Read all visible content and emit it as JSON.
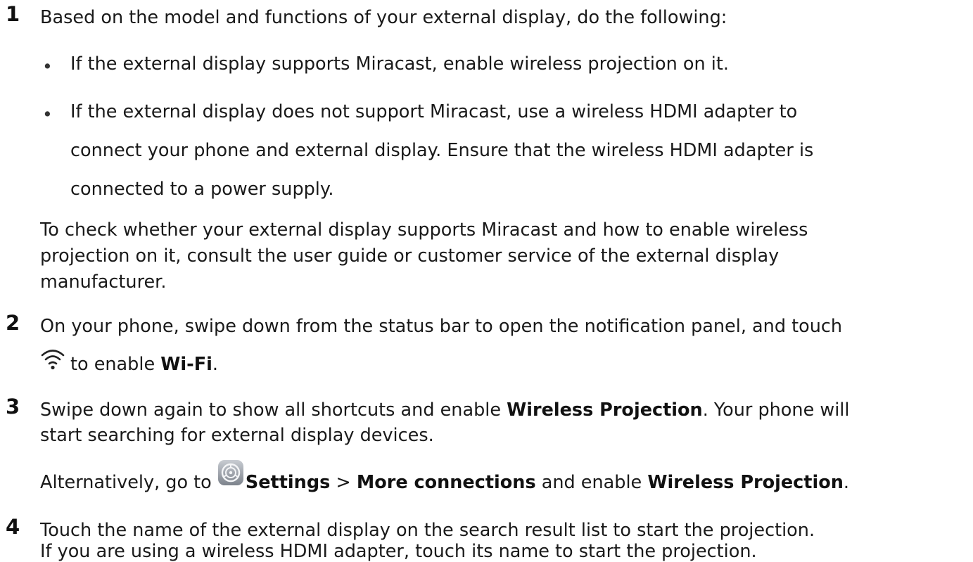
{
  "steps": [
    {
      "number": "1",
      "text": "Based on the model and functions of your external display, do the following:",
      "bullets": [
        {
          "lines": [
            "If the external display supports Miracast, enable wireless projection on it."
          ]
        },
        {
          "lines": [
            "If the external display does not support Miracast, use a wireless HDMI adapter to",
            "connect your phone and external display. Ensure that the wireless HDMI adapter is",
            "connected to a power supply."
          ]
        }
      ],
      "note_lines": [
        "To check whether your external display supports Miracast and how to enable wireless",
        "projection on it, consult the user guide or customer service of the external display",
        "manufacturer."
      ]
    },
    {
      "number": "2",
      "line1": "On your phone, swipe down from the status bar to open the notification panel, and touch",
      "line2_pre": "to enable ",
      "line2_bold": "Wi-Fi",
      "line2_post": ".",
      "icon": "wifi-icon"
    },
    {
      "number": "3",
      "line1_pre": "Swipe down again to show all shortcuts and enable ",
      "line1_bold": "Wireless Projection",
      "line1_post": ". Your phone will",
      "line2": "start searching for external display devices.",
      "alt_pre": "Alternatively, go to ",
      "alt_icon": "settings-icon",
      "alt_settings": "Settings",
      "alt_sep": " > ",
      "alt_more": "More connections",
      "alt_mid": " and enable ",
      "alt_wp": "Wireless Projection",
      "alt_end": "."
    },
    {
      "number": "4",
      "line1": "Touch the name of the external display on the search result list to start the projection.",
      "line2": "If you are using a wireless HDMI adapter, touch its name to start the projection."
    }
  ],
  "bullet_glyph": "•"
}
